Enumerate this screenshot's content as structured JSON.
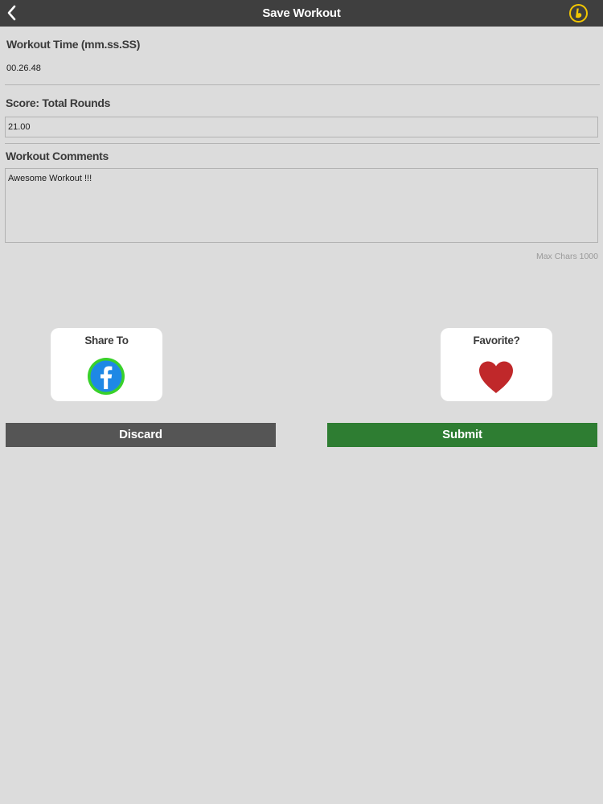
{
  "header": {
    "title": "Save Workout"
  },
  "workout_time": {
    "label": "Workout Time (mm.ss.SS)",
    "value": "00.26.48"
  },
  "score": {
    "label": "Score: Total Rounds",
    "value": "21.00"
  },
  "comments": {
    "label": "Workout Comments",
    "value": "Awesome Workout !!!",
    "max_chars_text": "Max Chars 1000"
  },
  "share": {
    "label": "Share To"
  },
  "favorite": {
    "label": "Favorite?"
  },
  "actions": {
    "discard_label": "Discard",
    "submit_label": "Submit"
  },
  "icons": {
    "back": "chevron-left-icon",
    "brand": "brand-logo-icon",
    "share": "facebook-icon",
    "favorite": "heart-icon"
  },
  "colors": {
    "header_bg": "#3f3f3f",
    "page_bg": "#dcdcdc",
    "brand_yellow": "#f2c600",
    "facebook_blue": "#1e88e5",
    "facebook_ring": "#39d12a",
    "heart_red": "#c0282a",
    "discard_bg": "#555555",
    "submit_bg": "#2e7d32"
  }
}
